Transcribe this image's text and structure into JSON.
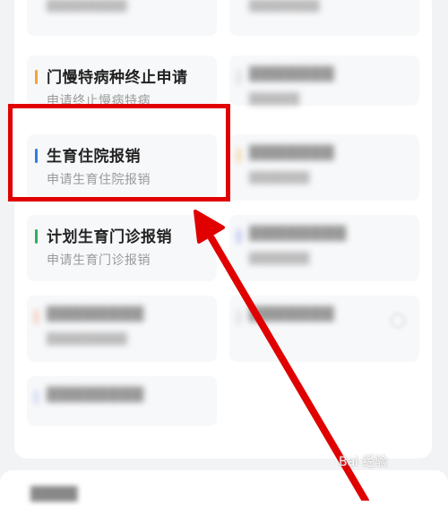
{
  "cards": [
    {
      "title": "门慢特病种终止申请",
      "sub": "申请终止慢病特病",
      "accent": "#f2a33a",
      "blur": false
    },
    {
      "title": "生育住院报销",
      "sub": "申请生育住院报销",
      "accent": "#2f7fd8",
      "blur": false
    },
    {
      "title": "计划生育门诊报销",
      "sub": "申请生育门诊报销",
      "accent": "#2fae5e",
      "blur": false
    }
  ],
  "watermark": "Bai 经验",
  "colors": {
    "highlight": "#e00000",
    "arrow": "#e00000"
  }
}
